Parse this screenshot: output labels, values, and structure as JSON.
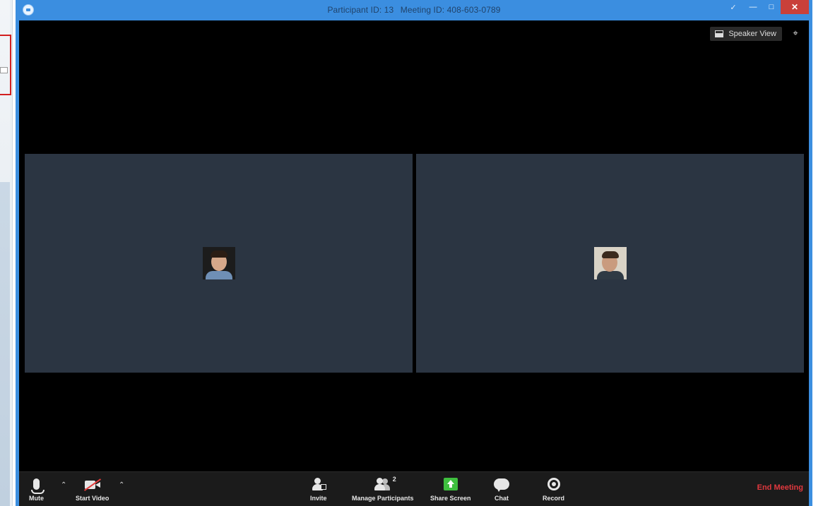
{
  "titlebar": {
    "participant": "Participant ID: 13",
    "meeting": "Meeting ID: 408-603-0789"
  },
  "view": {
    "speaker_view_label": "Speaker View"
  },
  "toolbar": {
    "mute_label": "Mute",
    "start_video_label": "Start Video",
    "invite_label": "Invite",
    "manage_participants_label": "Manage Participants",
    "participant_count": "2",
    "share_screen_label": "Share Screen",
    "chat_label": "Chat",
    "record_label": "Record",
    "end_meeting_label": "End Meeting"
  },
  "colors": {
    "titlebar": "#3b8ee0",
    "tile": "#2b3542",
    "share_green": "#3fbf3f",
    "end_red": "#e0383e"
  }
}
